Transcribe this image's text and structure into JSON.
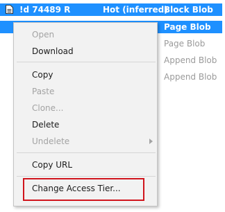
{
  "rows": [
    {
      "name": "!d 74489 R",
      "tier": "Hot (inferred)",
      "blob_type": "Block Blob"
    },
    {
      "name": "",
      "tier": "",
      "blob_type": "Page Blob"
    },
    {
      "name": "",
      "tier": "",
      "blob_type": "Page Blob"
    },
    {
      "name": "",
      "tier": "",
      "blob_type": "Append Blob"
    },
    {
      "name": "",
      "tier": "",
      "blob_type": "Append Blob"
    }
  ],
  "context_menu": {
    "open": "Open",
    "download": "Download",
    "copy": "Copy",
    "paste": "Paste",
    "clone": "Clone...",
    "delete": "Delete",
    "undelete": "Undelete",
    "copy_url": "Copy URL",
    "change_access_tier": "Change Access Tier..."
  },
  "colors": {
    "selection": "#1e90ff",
    "highlight_box": "#d0141c"
  }
}
